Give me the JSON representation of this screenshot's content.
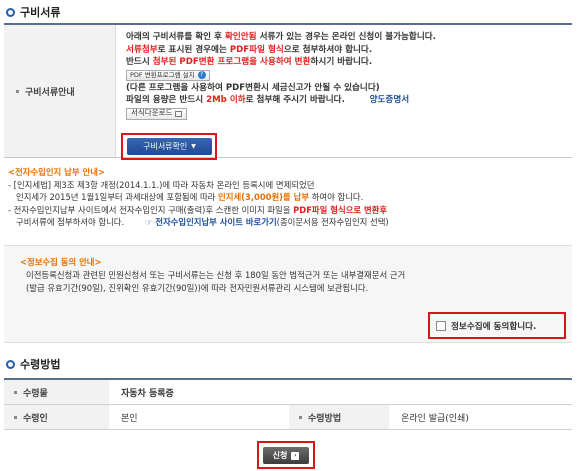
{
  "docs_section": {
    "title": "구비서류",
    "label": "구비서류안내",
    "lines": {
      "l1_a": "아래의 구비서류를 확인 후 ",
      "l1_b": "확인안됨",
      "l1_c": " 서류가 있는 경우는 온라인 신청이 불가능합니다.",
      "l2_a": "서류첨부",
      "l2_b": "로 표시된 경우에는 ",
      "l2_c": "PDF파일 형식",
      "l2_d": "으로 첨부하셔야 합니다.",
      "l3_a": "반드시 ",
      "l3_b": "첨부된 PDF변환 프로그램을 사용하여 변환",
      "l3_c": "하시기 바랍니다.",
      "pdf_button": "PDF 변환프로그램 설치",
      "l4": "(다른 프로그램을 사용하여 PDF변환시 세금신고가 안될 수 있습니다)",
      "l5_a": "파일의 용량은 반드시 ",
      "l5_b": "2Mb 이하",
      "l5_c": "로 첨부해 주시기 바랍니다.",
      "l5_d": "양도증명서",
      "form_download": "서식다운로드"
    },
    "confirm_button": "구비서류확인"
  },
  "stamp_info": {
    "title": "<전자수입인지 납부 안내>",
    "line1": "- [인지세법] 제3조 제3항 개정(2014.1.1.)에 따라 자동차 온라인 등록시에 면제되었던",
    "line2_a": "인지세가 2015년 1월1일부터 과세대상에 포함됨에 따라 ",
    "line2_b": "인지세(3,000원)를 납부",
    "line2_c": " 하여야 합니다.",
    "line3_a": "- 전자수입인지납부 사이트에서 전자수입인지 구매(출력)후 스캔한 이미지 파일을 ",
    "line3_b": "PDF파일 형식으로 변환후",
    "line4_a": "구비서류에 첨부하셔야 합니다.",
    "line4_b": "☞ 전자수입인지납부 사이트 바로가기",
    "line4_c": "(종이문서용 전자수입인지 선택)"
  },
  "privacy": {
    "title": "<정보수집 동의 안내>",
    "line1": "이전등록신청과 관련된 민원신청서 또는 구비서류는는 신청 후 180일 동안 법적근거 또는 내부결재문서 근거",
    "line2": "(발급 유효기간(90일), 진위확인 유효기간(90일))에 따라 전자민원서류관리 시스템에 보관됩니다.",
    "agree_label": "정보수집에 동의합니다."
  },
  "receipt_section": {
    "title": "수령방법",
    "row1": {
      "label": "수령물",
      "value": "자동차 등록증"
    },
    "row2": {
      "label1": "수령인",
      "value1": "본인",
      "label2": "수령방법",
      "value2": "온라인 발급(인쇄)"
    }
  },
  "submit_button": "신청",
  "colors": {
    "accent": "#d9141a",
    "link": "#1d4f9b",
    "warn": "#e87000"
  }
}
